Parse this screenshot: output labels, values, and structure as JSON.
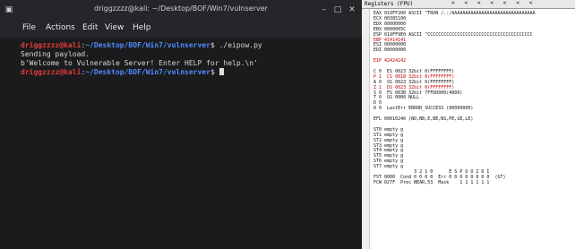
{
  "terminal": {
    "title": "driggzzzz@kali: ~/Desktop/BOF/Win7/vulnserver",
    "menu": [
      "File",
      "Actions",
      "Edit",
      "View",
      "Help"
    ],
    "lines": [
      {
        "user": "driggzzzz@kali",
        "path": "~/Desktop/BOF/Win7/vulnserver",
        "cmd": "$ ./eipow.py"
      },
      {
        "text": "Sending payload."
      },
      {
        "text": "b'Welcome to Vulnerable Server! Enter HELP for help.\\n'"
      },
      {
        "user": "driggzzzz@kali",
        "path": "~/Desktop/BOF/Win7/vulnserver",
        "cmd": "$ "
      }
    ]
  },
  "registers": {
    "header": "Registers (FPU)",
    "lines": [
      "EAX 019FF200 ASCII \"TRUN /.:/AAAAAAAAAAAAAAAAAAAAAAAAAAAAAAA",
      "ECX 00385100",
      "EDX 00000000",
      "EBX 0000005C",
      "ESP 019FF9E0 ASCII \"CCCCCCCCCCCCCCCCCCCCCCCCCCCCCCCCCCCCCCC",
      "EBP 41414141",
      "ESI 00000000",
      "EDI 00000000",
      "",
      "EIP 42424242",
      "",
      "C 0  ES 0023 32bit 0(FFFFFFFF)",
      "P 1  CS 001B 32bit 0(FFFFFFFF)",
      "A 0  SS 0023 32bit 0(FFFFFFFF)",
      "Z 1  DS 0023 32bit 0(FFFFFFFF)",
      "S 0  FS 003B 32bit 7FFDD000(4000)",
      "T 0  GS 0000 NULL",
      "D 0",
      "O 0  LastErr ERROR_SUCCESS (00000000)",
      "",
      "EFL 00010246 (NO,NB,E,BE,NS,PE,GE,LE)",
      "",
      "ST0 empty g",
      "ST1 empty g",
      "ST2 empty g",
      "ST3 empty g",
      "ST4 empty g",
      "ST5 empty g",
      "ST6 empty g",
      "ST7 empty g",
      "               3 2 1 0      E S P U O Z D I",
      "FST 0000  Cond 0 0 0 0  Err 0 0 0 0 0 0 0 0  (GT)",
      "FCW 027F  Prec NEAR,53  Mask    1 1 1 1 1 1"
    ],
    "red_rows": [
      5,
      9,
      12,
      14
    ]
  }
}
